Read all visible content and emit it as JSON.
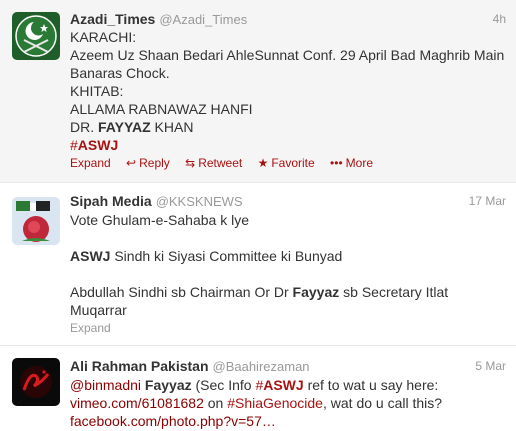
{
  "tweets": [
    {
      "fullname": "Azadi_Times",
      "username": "@Azadi_Times",
      "time": "4h",
      "lines": [
        "KARACHI:",
        "Azeem Uz Shaan Bedari AhleSunnat Conf. 29 April Bad Maghrib Main",
        "Banaras Chock.",
        "KHITAB:",
        "ALLAMA RABNAWAZ HANFI",
        "DR. ",
        "FAYYAZ",
        " KHAN",
        "#",
        "ASWJ"
      ],
      "actions": {
        "expand": "Expand",
        "reply": "Reply",
        "retweet": "Retweet",
        "favorite": "Favorite",
        "more": "More"
      }
    },
    {
      "fullname": "Sipah Media",
      "username": "@KKSKNEWS",
      "time": "17 Mar",
      "lines": [
        "Vote Ghulam-e-Sahaba k lye",
        "ASWJ",
        " Sindh ki Siyasi Committee ki Bunyad",
        "Abdullah Sindhi sb Chairman Or Dr ",
        "Fayyaz",
        " sb Secretary Itlat",
        "Muqarrar"
      ],
      "expand": "Expand"
    },
    {
      "fullname": "Ali Rahman Pakistan",
      "username": "@Baahirezaman",
      "time": "5 Mar",
      "parts": {
        "mention": "@binmadni",
        "fayyaz": "Fayyaz",
        "t1": " (Sec Info ",
        "hash_sym": "#",
        "aswj": "ASWJ",
        "t2": " ref to wat u say here:",
        "url1": "vimeo.com/61081682",
        "t3": " on ",
        "shia_tag": "#ShiaGenocide",
        "t4": ", wat do u call this?",
        "url2": "facebook.com/photo.php?v=57…"
      }
    }
  ],
  "colors": {
    "link": "#8b0000",
    "hashtag": "#aa1111",
    "muted": "#999999",
    "selected_bg": "#f5f5f5"
  },
  "icons": {
    "avatar0": "pakistan-flag-swords-icon",
    "avatar1": "flag-rose-icon",
    "avatar2": "ali-calligraphy-icon",
    "reply": "reply-arrow-icon",
    "retweet": "retweet-icon",
    "favorite": "star-icon",
    "more": "ellipsis-icon"
  }
}
